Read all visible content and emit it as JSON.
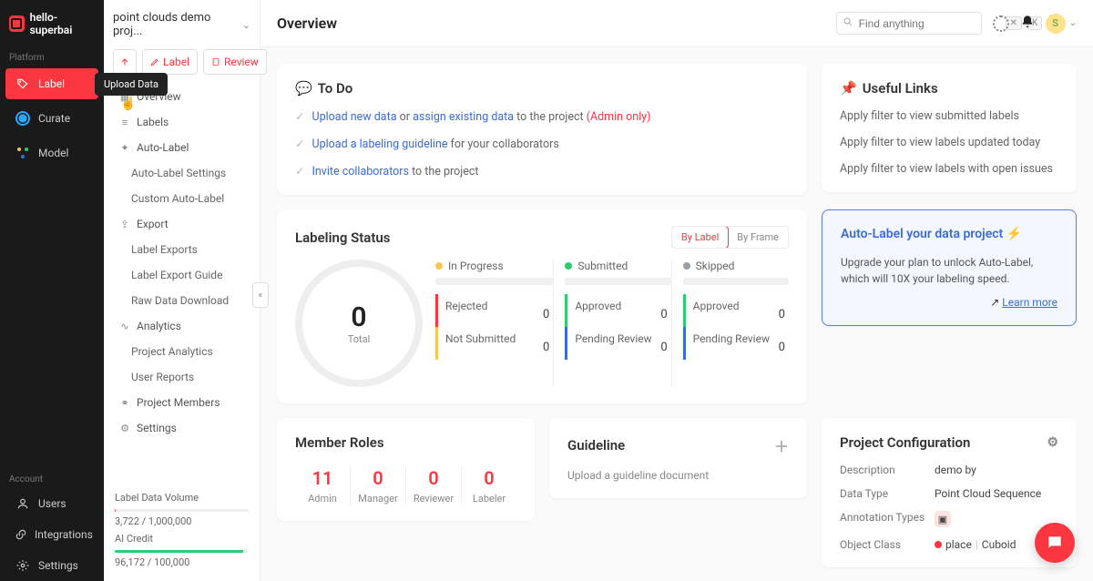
{
  "brand": "hello-superbai",
  "platform_label": "Platform",
  "nav": {
    "label": "Label",
    "curate": "Curate",
    "model": "Model"
  },
  "account_label": "Account",
  "account_nav": {
    "users": "Users",
    "integrations": "Integrations",
    "settings": "Settings"
  },
  "project_name": "point clouds demo proj...",
  "toolbar": {
    "label": "Label",
    "review": "Review",
    "tooltip": "Upload Data"
  },
  "projnav": {
    "overview": "Overview",
    "labels": "Labels",
    "auto_label": "Auto-Label",
    "auto_label_settings": "Auto-Label Settings",
    "custom_auto_label": "Custom Auto-Label",
    "export": "Export",
    "label_exports": "Label Exports",
    "label_export_guide": "Label Export Guide",
    "raw_data_download": "Raw Data Download",
    "analytics": "Analytics",
    "project_analytics": "Project Analytics",
    "user_reports": "User Reports",
    "project_members": "Project Members",
    "settings": "Settings"
  },
  "stats": {
    "label_data_volume_label": "Label Data Volume",
    "label_data_volume_value": "3,722 / 1,000,000",
    "ai_credit_label": "AI Credit",
    "ai_credit_value": "96,172 / 100,000",
    "ai_credit_fill_pct": 96
  },
  "page_title": "Overview",
  "search": {
    "placeholder": "Find anything",
    "shortcut1": "✕",
    "shortcut2": "K"
  },
  "avatar_initial": "S",
  "todo": {
    "title": "To Do",
    "row1_a": "Upload new data",
    "row1_b": " or ",
    "row1_c": "assign existing data",
    "row1_d": " to the project ",
    "row1_e": "(Admin only)",
    "row2_a": "Upload a labeling guideline",
    "row2_b": " for your collaborators",
    "row3_a": "Invite collaborators",
    "row3_b": " to the project"
  },
  "useful": {
    "title": "Useful Links",
    "items": [
      "Apply filter to view submitted labels",
      "Apply filter to view labels updated today",
      "Apply filter to view labels with open issues"
    ]
  },
  "status": {
    "title": "Labeling Status",
    "seg": {
      "by_label": "By Label",
      "by_frame": "By Frame"
    },
    "total_value": "0",
    "total_label": "Total",
    "legends": {
      "in_progress": "In Progress",
      "submitted": "Submitted",
      "skipped": "Skipped"
    },
    "metrics": {
      "rejected": "Rejected",
      "rejected_v": "0",
      "approved": "Approved",
      "approved_v": "0",
      "approved2": "Approved",
      "approved2_v": "0",
      "not_submitted": "Not Submitted",
      "not_submitted_v": "0",
      "pending1": "Pending Review",
      "pending1_v": "0",
      "pending2": "Pending Review",
      "pending2_v": "0"
    },
    "colors": {
      "in_progress": "#f6c74d",
      "submitted": "#2ecc71",
      "skipped": "#9aa0a6"
    }
  },
  "promo": {
    "title": "Auto-Label your data project ⚡",
    "body": "Upgrade your plan to unlock Auto-Label, which will 10X your labeling speed.",
    "learn": "Learn more"
  },
  "config": {
    "title": "Project Configuration",
    "desc_k": "Description",
    "desc_v": "demo by",
    "dtype_k": "Data Type",
    "dtype_v": "Point Cloud Sequence",
    "annot_k": "Annotation Types",
    "obj_k": "Object Class",
    "obj_name": "place",
    "obj_shape": "Cuboid"
  },
  "roles": {
    "title": "Member Roles",
    "items": [
      {
        "count": "11",
        "label": "Admin",
        "highlight": true
      },
      {
        "count": "0",
        "label": "Manager",
        "highlight": true
      },
      {
        "count": "0",
        "label": "Reviewer",
        "highlight": true
      },
      {
        "count": "0",
        "label": "Labeler",
        "highlight": true
      }
    ]
  },
  "guideline": {
    "title": "Guideline",
    "empty": "Upload a guideline document"
  }
}
